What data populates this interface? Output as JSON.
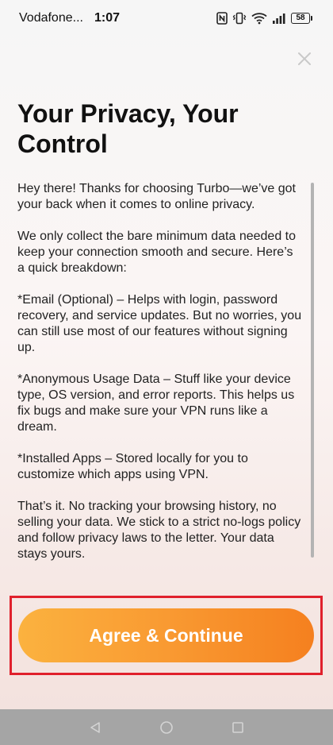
{
  "status_bar": {
    "carrier": "Vodafone...",
    "time": "1:07",
    "battery_level": "58",
    "icons": [
      "nfc-icon",
      "vibrate-icon",
      "wifi-icon",
      "signal-icon",
      "battery-icon"
    ]
  },
  "close": {
    "icon": "close-icon"
  },
  "title": "Your Privacy, Your Control",
  "policy": {
    "paragraphs": [
      "Hey there! Thanks for choosing Turbo—we’ve got your back when it comes to online privacy.",
      "We only collect the bare minimum data needed to keep your connection smooth and secure. Here’s a quick breakdown:",
      "*Email (Optional) – Helps with login, password recovery, and service updates. But no worries, you can still use most of our features without signing up.",
      "*Anonymous Usage Data – Stuff like your device type, OS version, and error reports. This helps us fix bugs and make sure your VPN runs like a dream.",
      "*Installed Apps – Stored locally for you to customize which apps using VPN.",
      "That’s it. No tracking your browsing history, no selling your data. We stick to a strict no-logs policy and follow privacy laws to the letter. Your data stays yours."
    ]
  },
  "agree_button": {
    "label": "Agree & Continue"
  },
  "colors": {
    "button_start": "#fbb23f",
    "button_end": "#f5801f",
    "highlight_frame": "#e0202c",
    "nav_bar": "#a5a5a5"
  },
  "nav_bar": {
    "icons": [
      "back-icon",
      "home-icon",
      "recents-icon"
    ]
  }
}
